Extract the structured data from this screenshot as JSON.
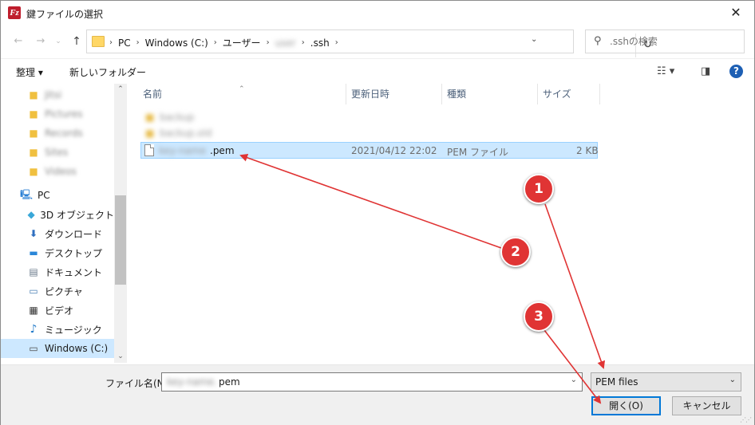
{
  "window": {
    "app_icon_glyph": "Fz",
    "title": "鍵ファイルの選択",
    "close_glyph": "✕"
  },
  "address": {
    "crumbs": [
      "PC",
      "Windows (C:)",
      "ユーザー",
      "user",
      ".ssh"
    ],
    "search_placeholder": ".sshの検索"
  },
  "toolbar": {
    "organize": "整理 ▾",
    "new_folder": "新しいフォルダー"
  },
  "nav": {
    "blurred_items": [
      "Jitsi",
      "Pictures",
      "Records",
      "Sites",
      "Videos"
    ],
    "pc_label": "PC",
    "items": [
      {
        "label": "3D オブジェクト"
      },
      {
        "label": "ダウンロード"
      },
      {
        "label": "デスクトップ"
      },
      {
        "label": "ドキュメント"
      },
      {
        "label": "ピクチャ"
      },
      {
        "label": "ビデオ"
      },
      {
        "label": "ミュージック"
      },
      {
        "label": "Windows (C:)"
      }
    ]
  },
  "columns": {
    "name": "名前",
    "modified": "更新日時",
    "type": "種類",
    "size": "サイズ"
  },
  "files": {
    "blurred_folders": [
      "backup",
      "backup.old"
    ],
    "selected": {
      "name_hidden": "key-name",
      "name_suffix": ".pem",
      "modified": "2021/04/12 22:02",
      "type": "PEM ファイル",
      "size": "2 KB"
    }
  },
  "bottom": {
    "filename_label": "ファイル名(N):",
    "filename_hidden": "key-name.",
    "filename_value": "pem",
    "filetype_value": "PEM files",
    "open_button": "開く(O)",
    "cancel_button": "キャンセル"
  },
  "annotations": {
    "color": "#e03434",
    "badges": [
      "1",
      "2",
      "3"
    ]
  }
}
